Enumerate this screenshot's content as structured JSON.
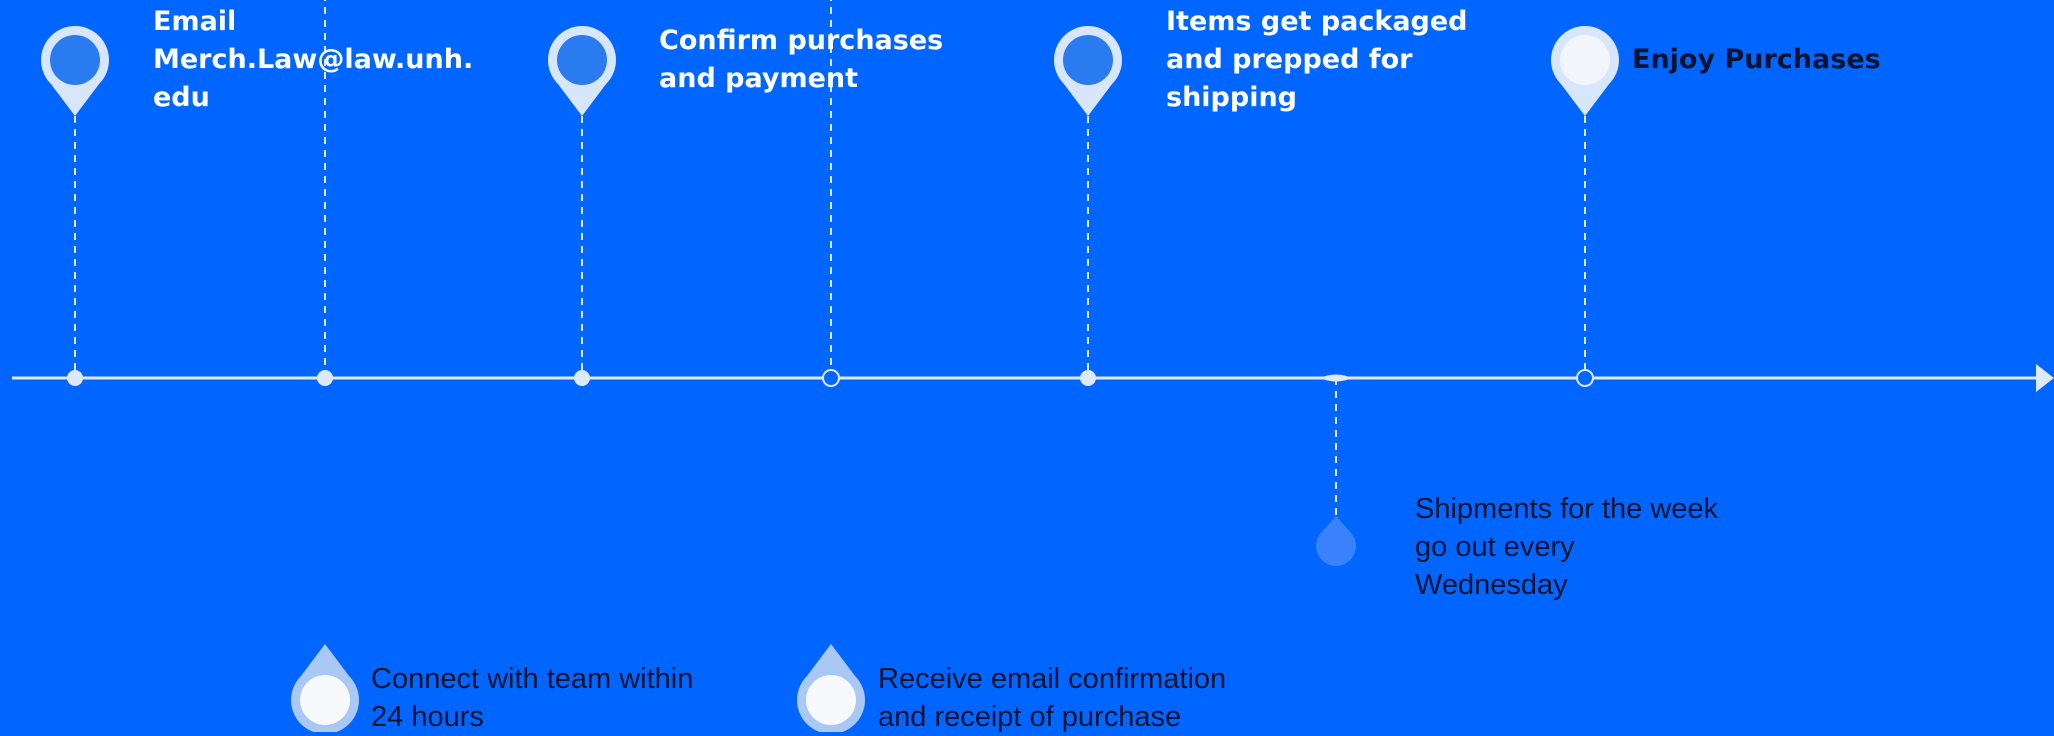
{
  "timeline": {
    "colors": {
      "background": "#0066ff",
      "axis": "#dfe8f5",
      "pin_outer": "#d7e6fa",
      "pin_inner": "#2b7bf0",
      "pin_inner_final": "#f2f6fc",
      "bottom_pin_outer": "#a9c8f3",
      "bottom_pin_inner": "#f7f9fd",
      "faint_drop": "#3a82fb",
      "label_light": "#ffffff",
      "label_dark": "#0a1430"
    },
    "steps": [
      {
        "id": "email",
        "position": "top",
        "style": "blue",
        "label": "Email\nMerch.Law@law.unh.\nedu"
      },
      {
        "id": "connect",
        "position": "bottom",
        "style": "white",
        "label": "Connect with team within\n24 hours"
      },
      {
        "id": "confirm",
        "position": "top",
        "style": "blue",
        "label": "Confirm purchases\nand payment"
      },
      {
        "id": "receipt",
        "position": "bottom",
        "style": "white",
        "label": "Receive email confirmation\nand receipt of purchase"
      },
      {
        "id": "packaged",
        "position": "top",
        "style": "blue",
        "label": "Items get packaged\nand prepped for\nshipping"
      },
      {
        "id": "shipments",
        "position": "bottom",
        "style": "faint",
        "label": "Shipments for the week\ngo out every\nWednesday"
      },
      {
        "id": "enjoy",
        "position": "top",
        "style": "white",
        "label": "Enjoy Purchases"
      }
    ]
  }
}
